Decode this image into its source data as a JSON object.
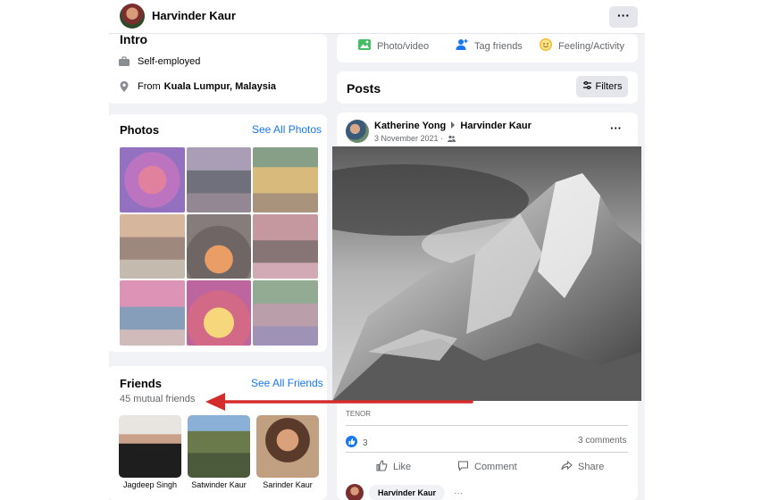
{
  "header": {
    "profile_name": "Harvinder Kaur",
    "more_label": "···"
  },
  "intro": {
    "title": "Intro",
    "work": "Self-employed",
    "from_prefix": "From",
    "from_place": "Kuala Lumpur, Malaysia"
  },
  "composer": {
    "photo_label": "Photo/video",
    "tag_label": "Tag friends",
    "feeling_label": "Feeling/Activity"
  },
  "posts_bar": {
    "title": "Posts",
    "filters_label": "Filters"
  },
  "photos": {
    "title": "Photos",
    "see_all": "See All Photos"
  },
  "friends": {
    "title": "Friends",
    "see_all": "See All Friends",
    "mutual": "45 mutual friends",
    "items": [
      {
        "name": "Jagdeep Singh"
      },
      {
        "name": "Satwinder Kaur"
      },
      {
        "name": "Sarinder Kaur"
      }
    ]
  },
  "post": {
    "author": "Katherine Yong",
    "target": "Harvinder Kaur",
    "date": "3 November 2021 ·",
    "menu": "···",
    "source": "TENOR",
    "reaction_count": "3",
    "comments_count": "3 comments",
    "like_label": "Like",
    "comment_label": "Comment",
    "share_label": "Share",
    "commenter_name": "Harvinder Kaur",
    "commenter_more": "···"
  },
  "colors": {
    "accent": "#1877f2",
    "annotation_arrow": "#d42c2c",
    "page_bg": "#f0f2f5"
  }
}
